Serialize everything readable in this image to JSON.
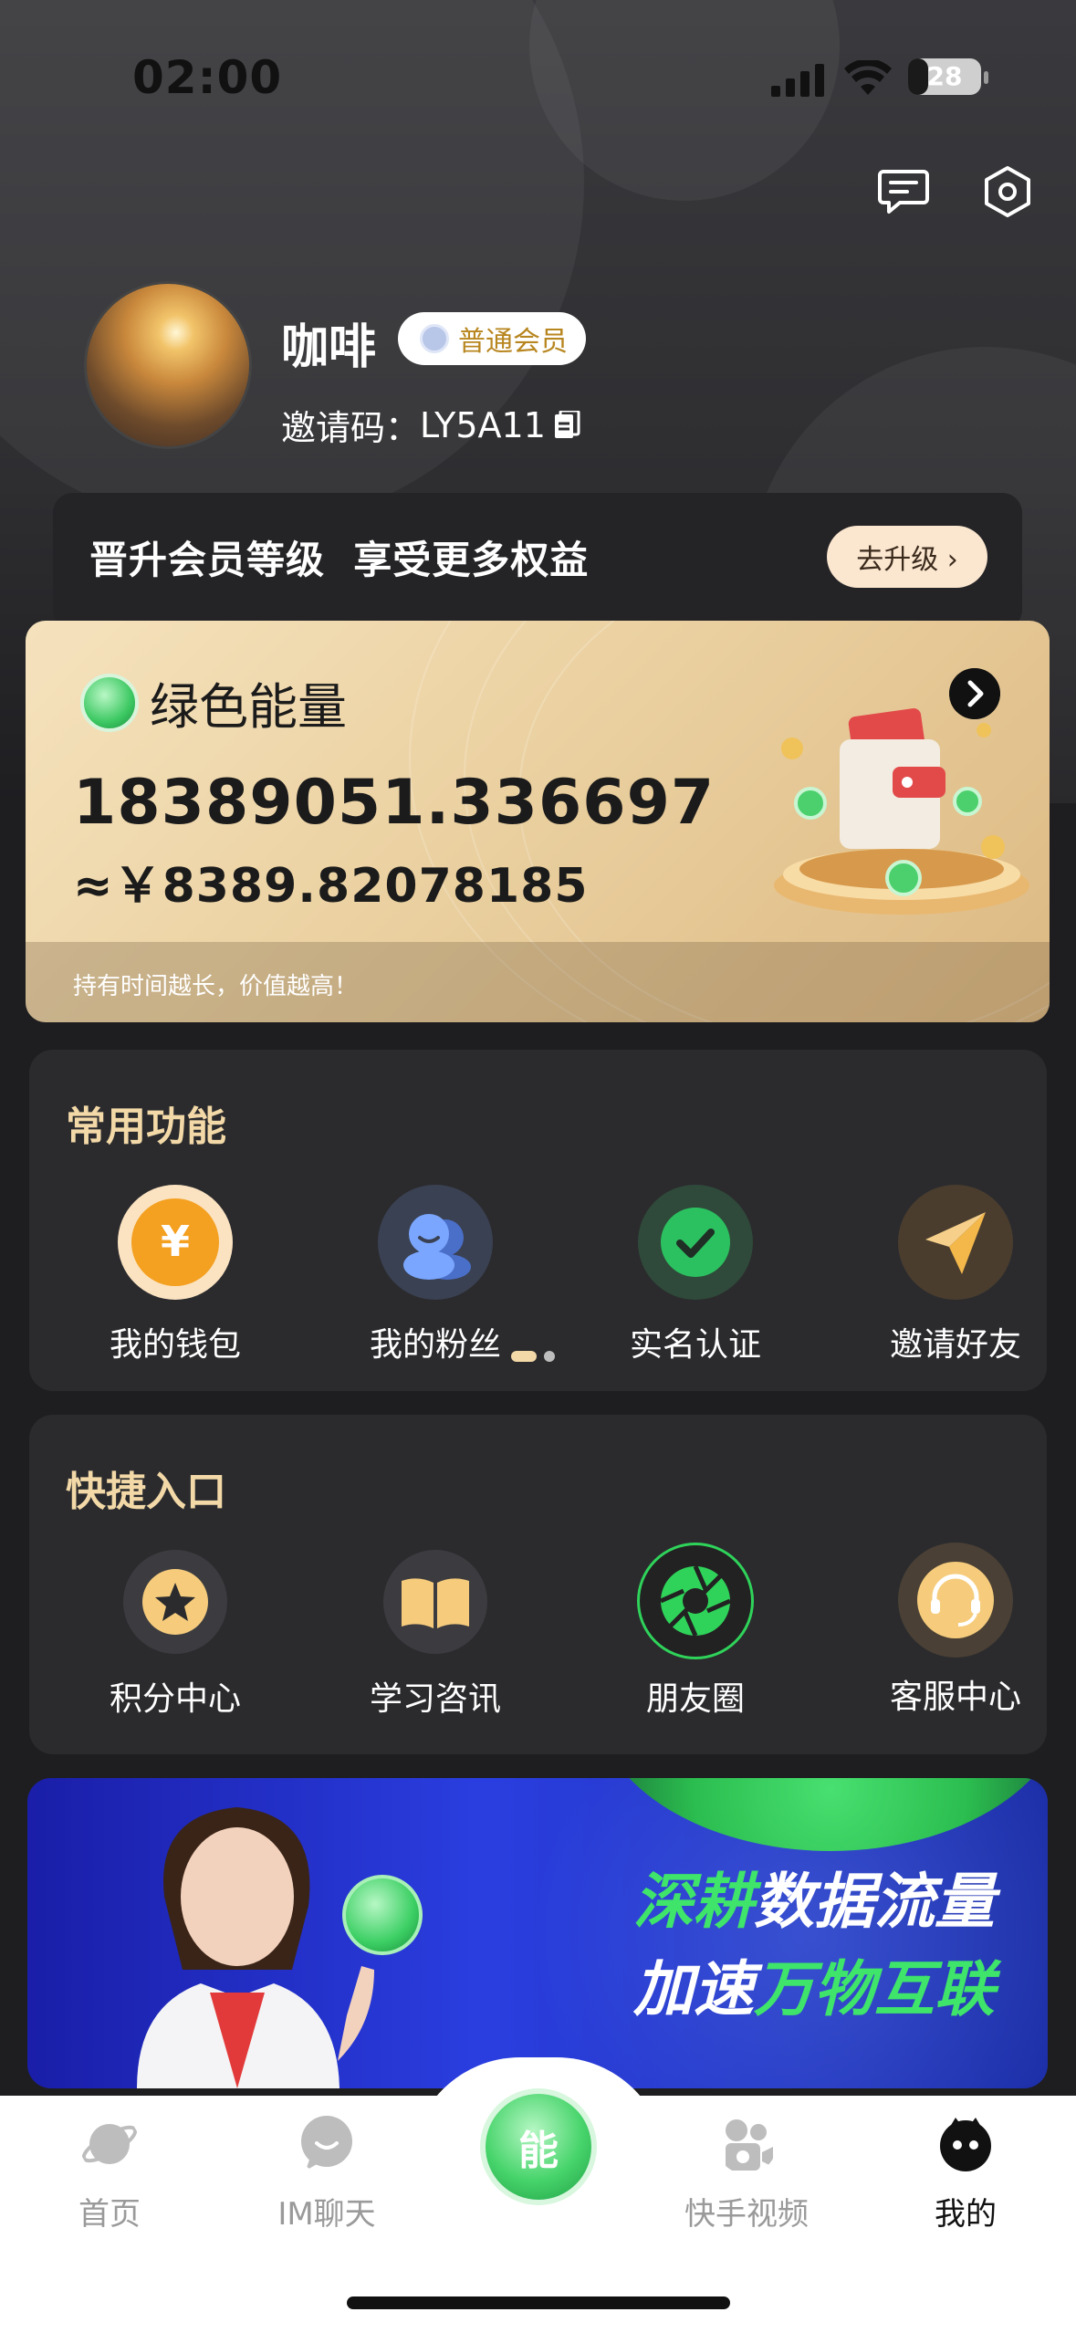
{
  "status_bar": {
    "time": "02:00",
    "battery": "28",
    "battery_level": 0.28
  },
  "profile": {
    "username": "咖啡",
    "member_level": "普通会员",
    "invite_label": "邀请码：",
    "invite_code": "LY5A11"
  },
  "upgrade": {
    "text": "晋升会员等级  享受更多权益",
    "button": "去升级 ›"
  },
  "energy": {
    "title": "绿色能量",
    "value": "18389051.336697",
    "cny": "≈￥8389.82078185",
    "note": "持有时间越长，价值越高！"
  },
  "common_functions": {
    "title": "常用功能",
    "items": [
      {
        "label": "我的钱包",
        "icon": "wallet-yen-icon"
      },
      {
        "label": "我的粉丝",
        "icon": "fans-icon"
      },
      {
        "label": "实名认证",
        "icon": "verify-check-icon"
      },
      {
        "label": "邀请好友",
        "icon": "paper-plane-icon"
      }
    ],
    "page_indicator": {
      "pages": 2,
      "current": 1
    }
  },
  "quick_entries": {
    "title": "快捷入口",
    "items": [
      {
        "label": "积分中心",
        "icon": "star-icon"
      },
      {
        "label": "学习咨讯",
        "icon": "book-icon"
      },
      {
        "label": "朋友圈",
        "icon": "aperture-icon"
      },
      {
        "label": "客服中心",
        "icon": "headset-icon"
      }
    ]
  },
  "banner": {
    "line1_green": "深耕",
    "line1_white": "数据流量",
    "line2_white": "加速",
    "line2_green": "万物互联"
  },
  "tabbar": {
    "items": [
      {
        "label": "首页",
        "icon": "planet-icon"
      },
      {
        "label": "IM聊天",
        "icon": "chat-icon"
      },
      {
        "label": "",
        "icon": "energy-center-icon"
      },
      {
        "label": "快手视频",
        "icon": "video-camera-icon"
      },
      {
        "label": "我的",
        "icon": "me-icon"
      }
    ],
    "active": "我的",
    "center_glyph": "能"
  },
  "colors": {
    "accent_gold": "#f3d9a7",
    "green": "#3fe46a",
    "panel": "#2b2b2e"
  }
}
